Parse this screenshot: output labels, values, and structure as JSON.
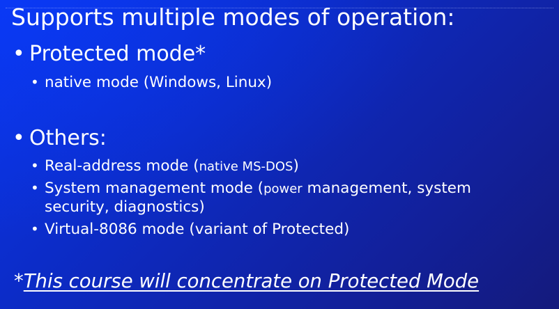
{
  "slide": {
    "title": "Supports multiple modes of operation:",
    "level1_bullet": "•",
    "level2_bullet": "•",
    "section_protected": {
      "label": "Protected mode*",
      "items": [
        {
          "text": "native mode (Windows, Linux)"
        }
      ]
    },
    "section_others": {
      "label": "Others:",
      "items": [
        {
          "main": "Real-address mode (",
          "detail": "native MS-DOS",
          "end": ")"
        },
        {
          "main": "System management mode (",
          "detail": "power",
          "rest_line1": " management, system",
          "line2": "security, diagnostics)"
        },
        {
          "text": "Virtual-8086 mode (variant of Protected)"
        }
      ]
    },
    "footnote": {
      "marker": "*",
      "text": "This course will concentrate on Protected Mode"
    }
  },
  "colors": {
    "background_start": "#0a36ea",
    "background_end": "#141a7c",
    "text": "#ffffff"
  }
}
